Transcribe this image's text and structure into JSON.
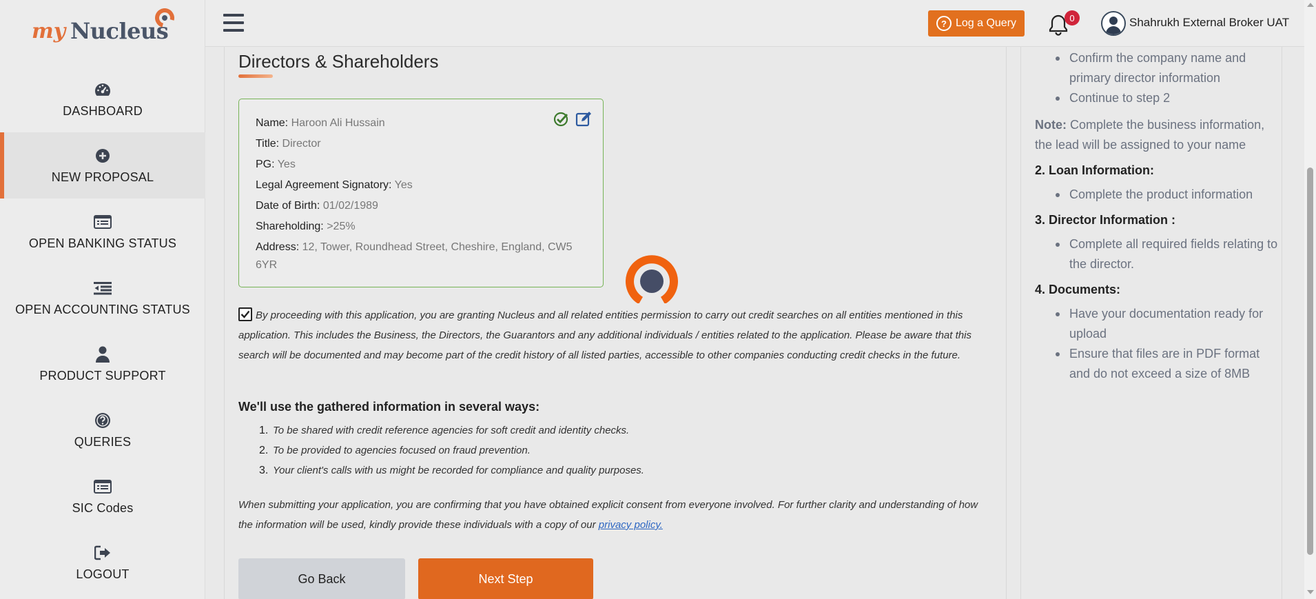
{
  "brand": {
    "logo_prefix": "my",
    "logo_name": "Nucleus",
    "accent_color": "#e2703a"
  },
  "sidebar": {
    "items": [
      {
        "label": "DASHBOARD",
        "icon": "dashboard-gauge-icon",
        "active": false
      },
      {
        "label": "NEW PROPOSAL",
        "icon": "plus-circle-icon",
        "active": true
      },
      {
        "label": "OPEN BANKING STATUS",
        "icon": "list-card-icon",
        "active": false
      },
      {
        "label": "OPEN ACCOUNTING STATUS",
        "icon": "outdent-list-icon",
        "active": false
      },
      {
        "label": "PRODUCT SUPPORT",
        "icon": "user-icon",
        "active": false
      },
      {
        "label": "QUERIES",
        "icon": "question-circle-icon",
        "active": false
      },
      {
        "label": "SIC Codes",
        "icon": "list-card-icon",
        "active": false
      },
      {
        "label": "LOGOUT",
        "icon": "sign-out-icon",
        "active": false
      }
    ]
  },
  "topbar": {
    "query_button": "Log a Query",
    "notification_count": "0",
    "user_name": "Shahrukh External Broker UAT"
  },
  "main": {
    "title": "Directors & Shareholders",
    "director": {
      "fields": [
        {
          "key": "Name:",
          "value": "Haroon Ali Hussain"
        },
        {
          "key": "Title:",
          "value": "Director"
        },
        {
          "key": "PG:",
          "value": "Yes"
        },
        {
          "key": "Legal Agreement Signatory:",
          "value": "Yes"
        },
        {
          "key": "Date of Birth:",
          "value": "01/02/1989"
        },
        {
          "key": "Shareholding:",
          "value": ">25%"
        },
        {
          "key": "Address:",
          "value": "12, Tower, Roundhead Street, Cheshire, England, CW5 6YR"
        }
      ]
    },
    "consent_checked": true,
    "consent_text": "By proceeding with this application, you are granting Nucleus and all related entities permission to carry out credit searches on all entities mentioned in this application. This includes the Business, the Directors, the Guarantors and any additional individuals / entities related to the application. Please be aware that this search will be documented and may become part of the credit history of all listed parties, accessible to other companies conducting credit checks in the future.",
    "ways_title": "We'll use the gathered information in several ways:",
    "ways": [
      {
        "num": "1.",
        "text": "To be shared with credit reference agencies for soft credit and identity checks."
      },
      {
        "num": "2.",
        "text": "To be provided to agencies focused on fraud prevention."
      },
      {
        "num": "3.",
        "text": "Your client's calls with us might be recorded for compliance and quality purposes."
      }
    ],
    "footer_text": "When submitting your application, you are confirming that you have obtained explicit consent from everyone involved. For further clarity and understanding of how the information will be used, kindly provide these individuals with a copy of our",
    "privacy_link": "privacy policy.",
    "back_button": "Go Back",
    "next_button": "Next Step"
  },
  "right_panel": {
    "step1_items": [
      "Confirm the company name and primary director information",
      "Continue to step 2"
    ],
    "note_label": "Note:",
    "note_text": "Complete the business information, the lead will be assigned to your name",
    "step2_title": "2. Loan Information:",
    "step2_items": [
      "Complete the product information"
    ],
    "step3_title": "3. Director Information :",
    "step3_items": [
      "Complete all required fields relating to the director."
    ],
    "step4_title": "4. Documents:",
    "step4_items": [
      "Have your documentation ready for upload",
      "Ensure that files are in PDF format and do not exceed a size of 8MB"
    ]
  }
}
